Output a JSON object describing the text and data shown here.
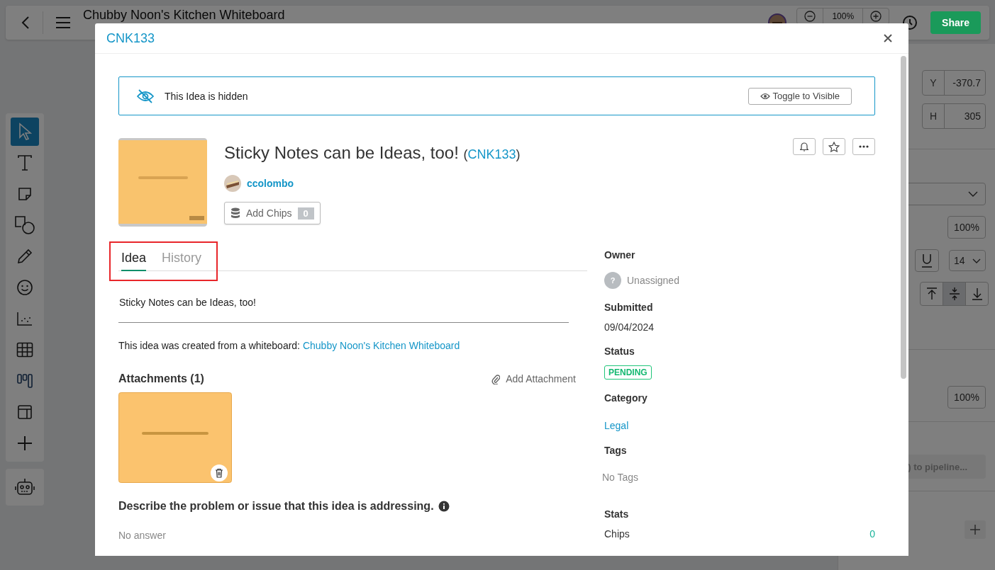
{
  "board": {
    "title": "Chubby Noon's Kitchen Whiteboard",
    "zoom": "100%",
    "share": "Share"
  },
  "tools": [
    {
      "kind": "select",
      "selected": true
    },
    {
      "kind": "text",
      "selected": false
    },
    {
      "kind": "sticky",
      "selected": false
    },
    {
      "kind": "shapes",
      "selected": false
    },
    {
      "kind": "pen",
      "selected": false
    },
    {
      "kind": "emoji",
      "selected": false
    },
    {
      "kind": "scatter",
      "selected": false
    },
    {
      "kind": "table",
      "selected": false
    },
    {
      "kind": "kanban",
      "selected": false
    },
    {
      "kind": "layout",
      "selected": false
    },
    {
      "kind": "add",
      "selected": false
    }
  ],
  "properties": {
    "y_label": "Y",
    "y_value": "-370.7",
    "h_label": "H",
    "h_value": "305",
    "opacity_a": "100%",
    "font_size": "14",
    "opacity_b": "100%",
    "pipeline_button": ") to pipeline...",
    "valign": [
      {
        "kind": "top",
        "selected": false
      },
      {
        "kind": "middle",
        "selected": true
      },
      {
        "kind": "bottom",
        "selected": false
      }
    ]
  },
  "modal": {
    "code": "CNK133",
    "hidden_banner": {
      "text": "This Idea is hidden",
      "button": "Toggle to Visible"
    },
    "idea": {
      "title": "Sticky Notes can be Ideas, too!",
      "code_open": "(",
      "code": "CNK133",
      "code_close": ")",
      "author": "ccolombo",
      "chips_button": "Add Chips",
      "chips_count": "0"
    },
    "tabs": [
      {
        "label": "Idea",
        "selected": true
      },
      {
        "label": "History",
        "selected": false
      }
    ],
    "tabs_highlighted": true,
    "description": "Sticky Notes can be Ideas, too!",
    "origin": {
      "text": "This idea was created from a whiteboard:",
      "link": "Chubby Noon's Kitchen Whiteboard"
    },
    "attachments": {
      "title": "Attachments (1)",
      "add": "Add Attachment"
    },
    "questions": [
      {
        "question": "Describe the problem or issue that this idea is addressing.",
        "answer": "No answer"
      }
    ],
    "details": [
      {
        "label": "Owner",
        "kind": "person",
        "avatar_mark": "?",
        "value": "Unassigned"
      },
      {
        "label": "Submitted",
        "kind": "text",
        "value": "09/04/2024"
      },
      {
        "label": "Status",
        "kind": "badge",
        "value": "PENDING"
      },
      {
        "label": "Category",
        "kind": "link",
        "value": "Legal"
      },
      {
        "label": "Tags",
        "kind": "empty",
        "value": "No Tags"
      },
      {
        "label": "Stats",
        "kind": "stats",
        "rows": [
          {
            "label": "Chips",
            "value": "0"
          }
        ]
      }
    ]
  }
}
